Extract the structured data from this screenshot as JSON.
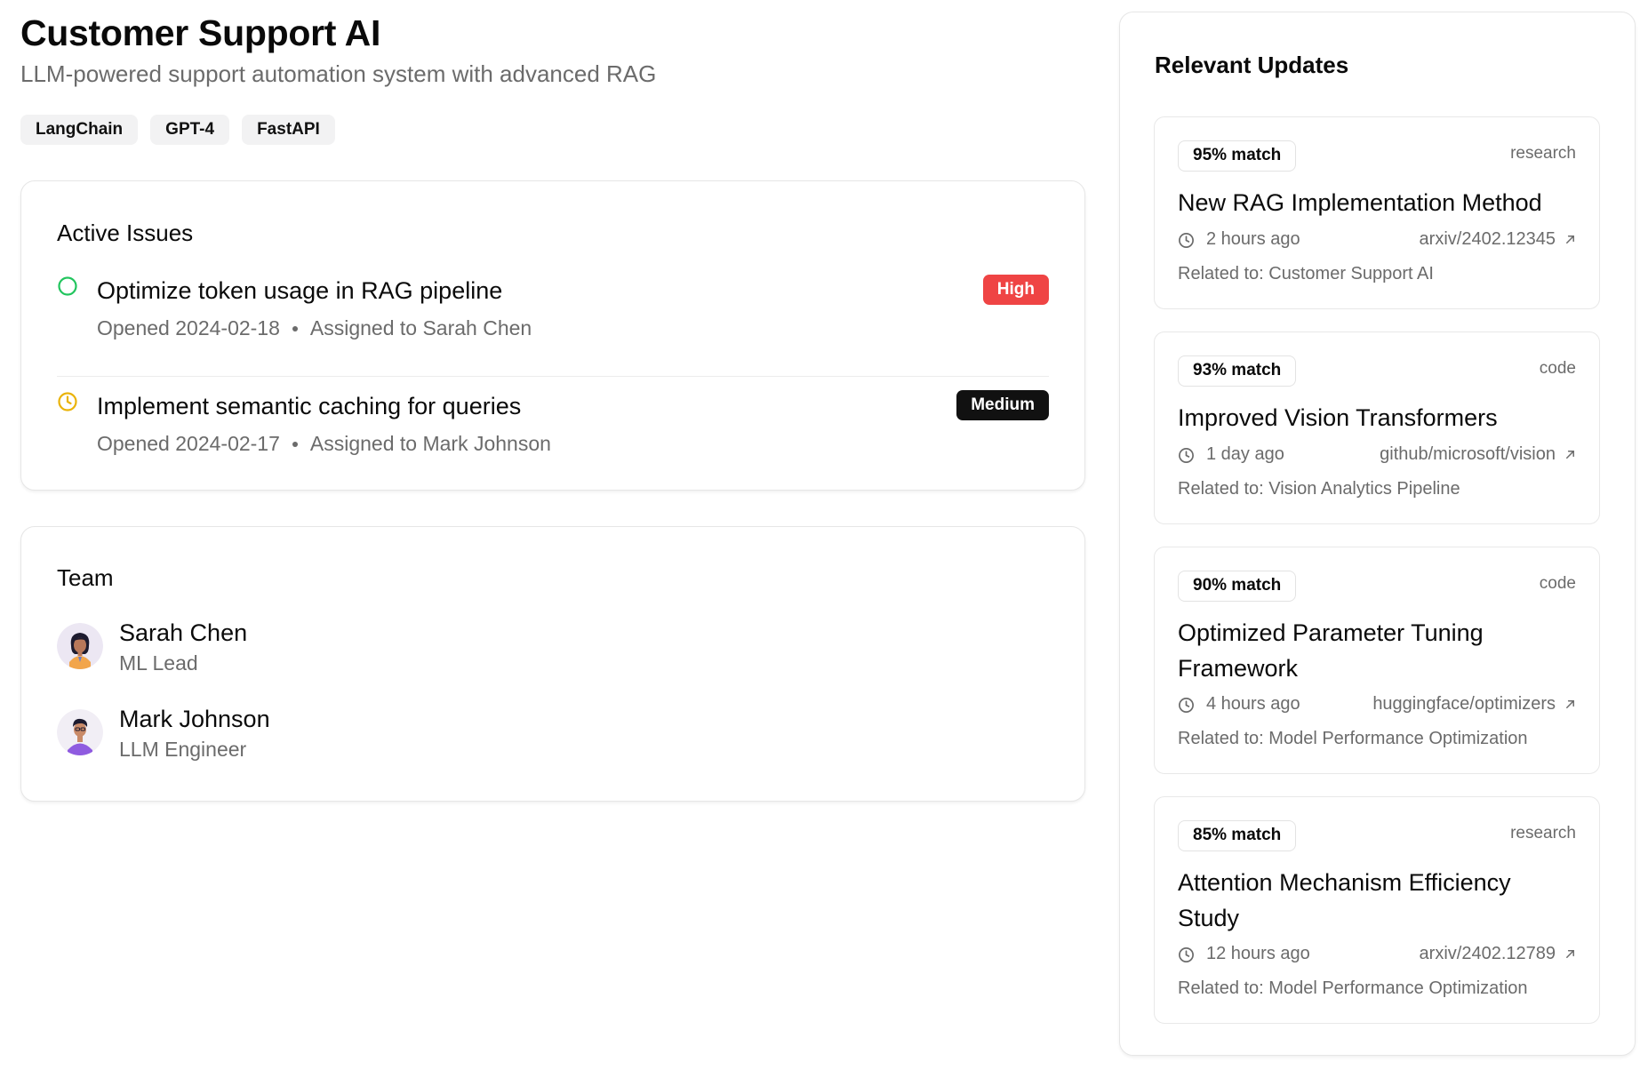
{
  "project": {
    "title": "Customer Support AI",
    "subtitle": "LLM-powered support automation system with advanced RAG",
    "tags": [
      "LangChain",
      "GPT-4",
      "FastAPI"
    ]
  },
  "issues": {
    "heading": "Active Issues",
    "items": [
      {
        "title": "Optimize token usage in RAG pipeline",
        "opened": "Opened 2024-02-18",
        "assigned": "Assigned to Sarah Chen",
        "priority": "High",
        "status_icon": "open-circle-icon",
        "status_color": "#22c55e",
        "priority_color": "#ef4444"
      },
      {
        "title": "Implement semantic caching for queries",
        "opened": "Opened 2024-02-17",
        "assigned": "Assigned to Mark Johnson",
        "priority": "Medium",
        "status_icon": "clock-icon",
        "status_color": "#eab308",
        "priority_color": "#111111"
      }
    ]
  },
  "team": {
    "heading": "Team",
    "members": [
      {
        "name": "Sarah Chen",
        "role": "ML Lead",
        "avatar": "avatar-illustration-woman"
      },
      {
        "name": "Mark Johnson",
        "role": "LLM Engineer",
        "avatar": "avatar-illustration-man"
      }
    ]
  },
  "updates": {
    "heading": "Relevant Updates",
    "items": [
      {
        "match": "95% match",
        "type": "research",
        "title": "New RAG Implementation Method",
        "time": "2 hours ago",
        "link": "arxiv/2402.12345",
        "related": "Related to: Customer Support AI"
      },
      {
        "match": "93% match",
        "type": "code",
        "title": "Improved Vision Transformers",
        "time": "1 day ago",
        "link": "github/microsoft/vision",
        "related": "Related to: Vision Analytics Pipeline"
      },
      {
        "match": "90% match",
        "type": "code",
        "title": "Optimized Parameter Tuning Framework",
        "time": "4 hours ago",
        "link": "huggingface/optimizers",
        "related": "Related to: Model Performance Optimization"
      },
      {
        "match": "85% match",
        "type": "research",
        "title": "Attention Mechanism Efficiency Study",
        "time": "12 hours ago",
        "link": "arxiv/2402.12789",
        "related": "Related to: Model Performance Optimization"
      }
    ]
  }
}
